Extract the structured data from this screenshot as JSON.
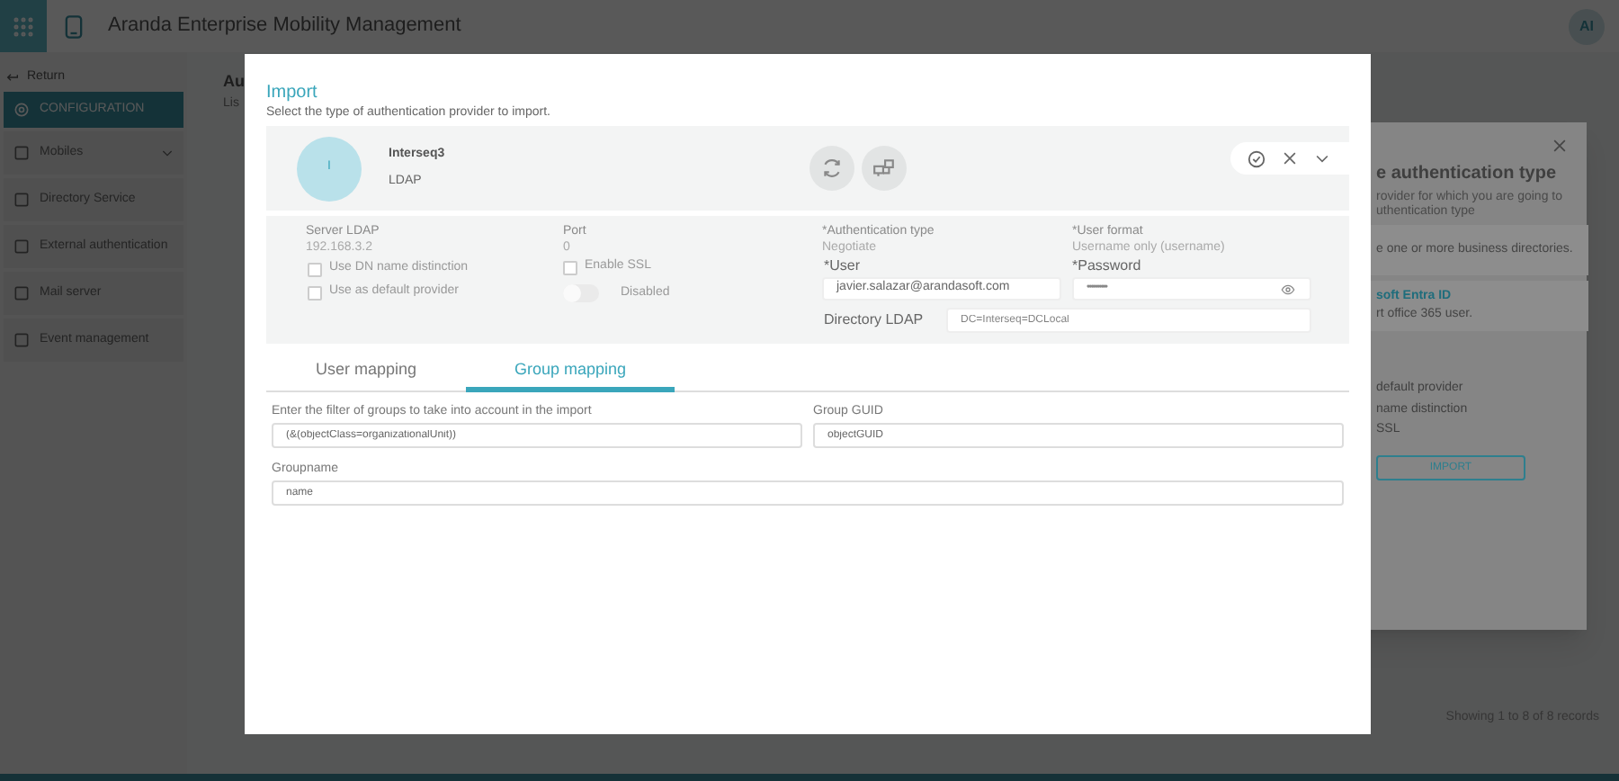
{
  "app_header": {
    "title": "Aranda Enterprise Mobility Management",
    "avatar": "AI"
  },
  "sidebar": {
    "return": "Return",
    "items": [
      {
        "label": "CONFIGURATION",
        "selected": true,
        "expandable": false
      },
      {
        "label": "Mobiles",
        "selected": false,
        "expandable": true
      },
      {
        "label": "Directory Service",
        "selected": false,
        "expandable": false
      },
      {
        "label": "External authentication",
        "selected": false,
        "expandable": false
      },
      {
        "label": "Mail server",
        "selected": false,
        "expandable": false
      },
      {
        "label": "Event management",
        "selected": false,
        "expandable": false
      }
    ]
  },
  "main": {
    "heading": "Au",
    "subheading": "Lis",
    "footer": "Showing 1 to 8 of 8 records"
  },
  "background_dialog": {
    "title": "e authentication type",
    "description": [
      "rovider for which you are going to",
      "uthentication type"
    ],
    "options": [
      {
        "text": "e one or more business directories."
      },
      {
        "title": "soft Entra ID",
        "text": "rt office 365 user."
      }
    ],
    "settings": [
      "default provider",
      "name distinction",
      "SSL"
    ],
    "import_button": "IMPORT"
  },
  "import_dialog": {
    "title": "Import",
    "subtitle": "Select the type of authentication provider to import.",
    "provider": {
      "initial": "I",
      "name": "Interseq3",
      "type": "LDAP"
    },
    "details": {
      "server_label": "Server LDAP",
      "server": "192.168.3.2",
      "port_label": "Port",
      "port": "0",
      "checkboxes": [
        {
          "label": "Use DN name distinction",
          "checked": false
        },
        {
          "label": "Use as default provider",
          "checked": false
        }
      ],
      "ssl": {
        "label": "Enable SSL",
        "checked": false
      },
      "toggle": {
        "label": "Disabled",
        "on": false
      },
      "auth_type_label": "*Authentication type",
      "auth_type": "Negotiate",
      "user_format_label": "*User format",
      "user_format": "Username only (username)",
      "user_label": "*User",
      "user": "javier.salazar@arandasoft.com",
      "password_label": "*Password",
      "password": "••••••••••",
      "directory_label": "Directory LDAP",
      "directory_placeholder": "DC=Interseq=DCLocal"
    },
    "tabs": [
      {
        "label": "User mapping",
        "selected": false
      },
      {
        "label": "Group mapping",
        "selected": true
      }
    ],
    "fields": [
      {
        "label": "Enter the filter of groups to take into account in the import",
        "value": "(&(objectClass=organizationalUnit))",
        "wide": false
      },
      {
        "label": "Group GUID",
        "value": "objectGUID",
        "wide": false
      },
      {
        "label": "Groupname",
        "value": "name",
        "wide": true
      }
    ]
  }
}
